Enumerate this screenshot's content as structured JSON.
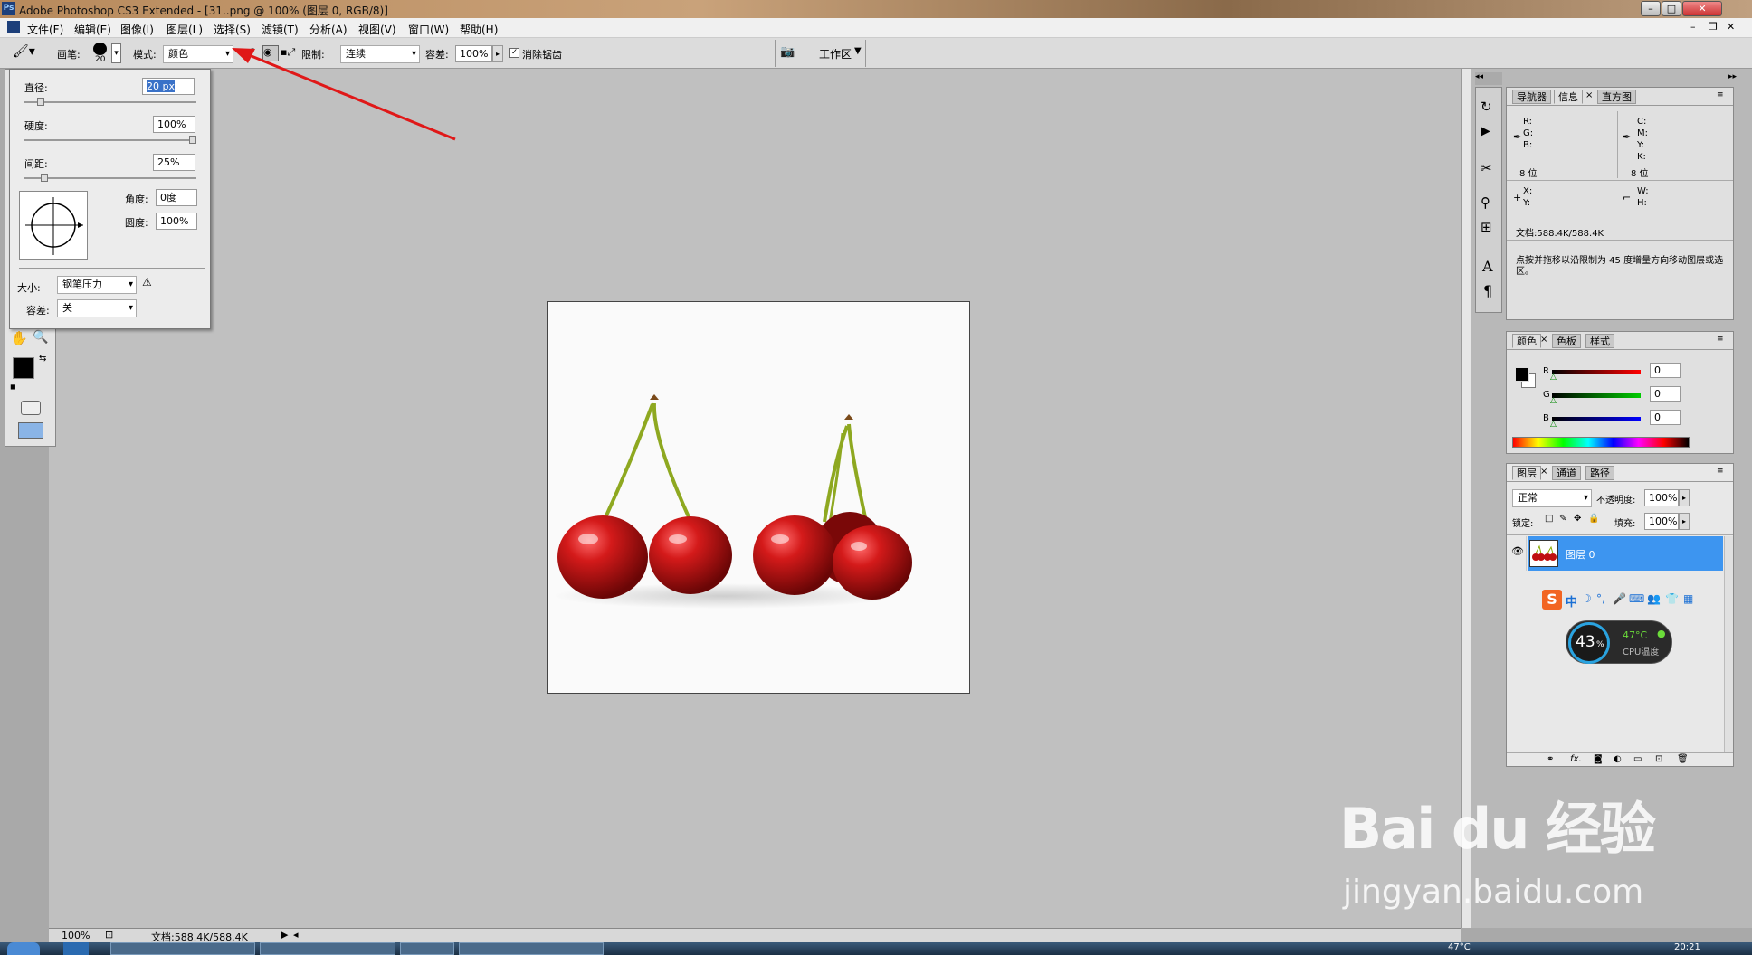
{
  "window": {
    "title": "Adobe Photoshop CS3 Extended - [31..png @ 100% (图层 0, RGB/8)]",
    "app_icon": "Ps"
  },
  "menu": [
    "文件(F)",
    "编辑(E)",
    "图像(I)",
    "图层(L)",
    "选择(S)",
    "滤镜(T)",
    "分析(A)",
    "视图(V)",
    "窗口(W)",
    "帮助(H)"
  ],
  "options": {
    "brush_label": "画笔:",
    "brush_size": "20",
    "mode_label": "模式:",
    "mode_value": "颜色",
    "limit_label": "限制:",
    "limit_value": "连续",
    "tolerance_label": "容差:",
    "tolerance_value": "100%",
    "antialias_label": "消除锯齿",
    "workspace": "工作区"
  },
  "brush_popup": {
    "diameter_label": "直径:",
    "diameter_value": "20 px",
    "hardness_label": "硬度:",
    "hardness_value": "100%",
    "spacing_label": "间距:",
    "spacing_value": "25%",
    "angle_label": "角度:",
    "angle_value": "0度",
    "roundness_label": "圆度:",
    "roundness_value": "100%",
    "size_label": "大小:",
    "size_value": "钢笔压力",
    "tolerance_label": "容差:",
    "tolerance_value": "关",
    "hardness_fill": 1.0,
    "spacing_fill": 0.12,
    "diameter_fill": 0.1
  },
  "info_panel": {
    "tabs": [
      "导航器",
      "信息",
      "直方图"
    ],
    "r": "R:",
    "g": "G:",
    "b": "B:",
    "c": "C:",
    "m": "M:",
    "y": "Y:",
    "k": "K:",
    "bits_left": "8 位",
    "bits_right": "8 位",
    "x": "X:",
    "yy": "Y:",
    "w": "W:",
    "h": "H:",
    "doc": "文档:588.4K/588.4K",
    "hint": "点按并拖移以沿限制为 45 度增量方向移动图层或选区。"
  },
  "color_panel": {
    "tabs": [
      "颜色",
      "色板",
      "样式"
    ],
    "r_label": "R",
    "g_label": "G",
    "b_label": "B",
    "r": "0",
    "g": "0",
    "b": "0"
  },
  "layers_panel": {
    "tabs": [
      "图层",
      "通道",
      "路径"
    ],
    "blend": "正常",
    "opacity_label": "不透明度:",
    "opacity": "100%",
    "lock_label": "锁定:",
    "fill_label": "填充:",
    "fill": "100%",
    "layer_name": "图层 0"
  },
  "status": {
    "zoom": "100%",
    "doc": "文档:588.4K/588.4K"
  },
  "cpu_widget": {
    "percent": "43",
    "unit": "%",
    "temp": "47°C",
    "label": "CPU温度"
  },
  "ime": {
    "items": [
      "中"
    ]
  },
  "watermark": {
    "brand": "Bai du 经验",
    "url": "jingyan.baidu.com"
  },
  "taskbar": {
    "temp": "47°C",
    "time": "20:21"
  },
  "colors": {
    "accent_arrow": "#e01818",
    "selected_layer": "#3d95f0"
  }
}
